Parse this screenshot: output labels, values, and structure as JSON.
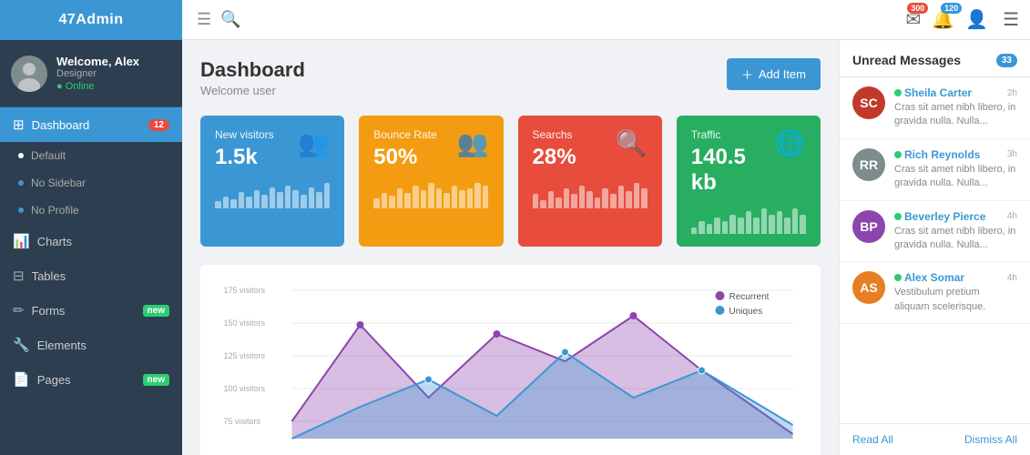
{
  "brand": "47Admin",
  "topnav": {
    "badge_email": "300",
    "badge_bell": "120"
  },
  "sidebar": {
    "user": {
      "name": "Welcome, Alex",
      "role": "Designer",
      "status": "Online"
    },
    "items": [
      {
        "id": "dashboard",
        "label": "Dashboard",
        "icon": "⊞",
        "badge": "12",
        "active": true
      },
      {
        "id": "default",
        "label": "Default",
        "sub": true
      },
      {
        "id": "no-sidebar",
        "label": "No Sidebar",
        "sub": true
      },
      {
        "id": "no-profile",
        "label": "No Profile",
        "sub": true
      },
      {
        "id": "charts",
        "label": "Charts",
        "icon": "📊"
      },
      {
        "id": "tables",
        "label": "Tables",
        "icon": "⊟"
      },
      {
        "id": "forms",
        "label": "Forms",
        "icon": "✏",
        "badge_new": "new"
      },
      {
        "id": "elements",
        "label": "Elements",
        "icon": "🔧"
      },
      {
        "id": "pages",
        "label": "Pages",
        "icon": "📄",
        "badge_new": "new"
      }
    ]
  },
  "page": {
    "title": "Dashboard",
    "subtitle": "Welcome user",
    "add_button": "Add Item"
  },
  "stats": [
    {
      "id": "new-visitors",
      "label": "New visitors",
      "value": "1.5k",
      "color": "blue",
      "bars": [
        3,
        5,
        4,
        7,
        5,
        8,
        6,
        9,
        7,
        10,
        8,
        6,
        9,
        7,
        11
      ]
    },
    {
      "id": "bounce-rate",
      "label": "Bounce Rate",
      "value": "50%",
      "color": "yellow",
      "bars": [
        4,
        6,
        5,
        8,
        6,
        9,
        7,
        10,
        8,
        6,
        9,
        7,
        8,
        10,
        9
      ]
    },
    {
      "id": "searches",
      "label": "Searchs",
      "value": "28%",
      "color": "red",
      "bars": [
        5,
        3,
        6,
        4,
        7,
        5,
        8,
        6,
        4,
        7,
        5,
        8,
        6,
        9,
        7
      ]
    },
    {
      "id": "traffic",
      "label": "Traffic",
      "value": "140.5 kb",
      "color": "green",
      "bars": [
        2,
        4,
        3,
        5,
        4,
        6,
        5,
        7,
        5,
        8,
        6,
        7,
        5,
        8,
        6
      ]
    }
  ],
  "chart": {
    "y_labels": [
      "175 visitors",
      "150 visitors",
      "125 visitors",
      "100 visitors",
      "75 visitors"
    ],
    "legend": [
      {
        "label": "Recurrent",
        "color": "#8e44ad"
      },
      {
        "label": "Uniques",
        "color": "#3b97d3"
      }
    ]
  },
  "messages": {
    "title": "Unread Messages",
    "count": "33",
    "items": [
      {
        "name": "Sheila Carter",
        "time": "2h",
        "text": "Cras sit amet nibh libero, in gravida nulla. Nulla...",
        "color": "#e74c3c",
        "initials": "SC"
      },
      {
        "name": "Rich Reynolds",
        "time": "3h",
        "text": "Cras sit amet nibh libero, in gravida nulla. Nulla...",
        "color": "#7f8c8d",
        "initials": "RR"
      },
      {
        "name": "Beverley Pierce",
        "time": "4h",
        "text": "Cras sit amet nibh libero, in gravida nulla. Nulla...",
        "color": "#e74c3c",
        "initials": "BP"
      },
      {
        "name": "Alex Somar",
        "time": "4h",
        "text": "Vestibulum pretium aliquam scelerisque.",
        "color": "#e74c3c",
        "initials": "AS"
      }
    ],
    "read_all": "Read All",
    "dismiss_all": "Dismiss All"
  }
}
